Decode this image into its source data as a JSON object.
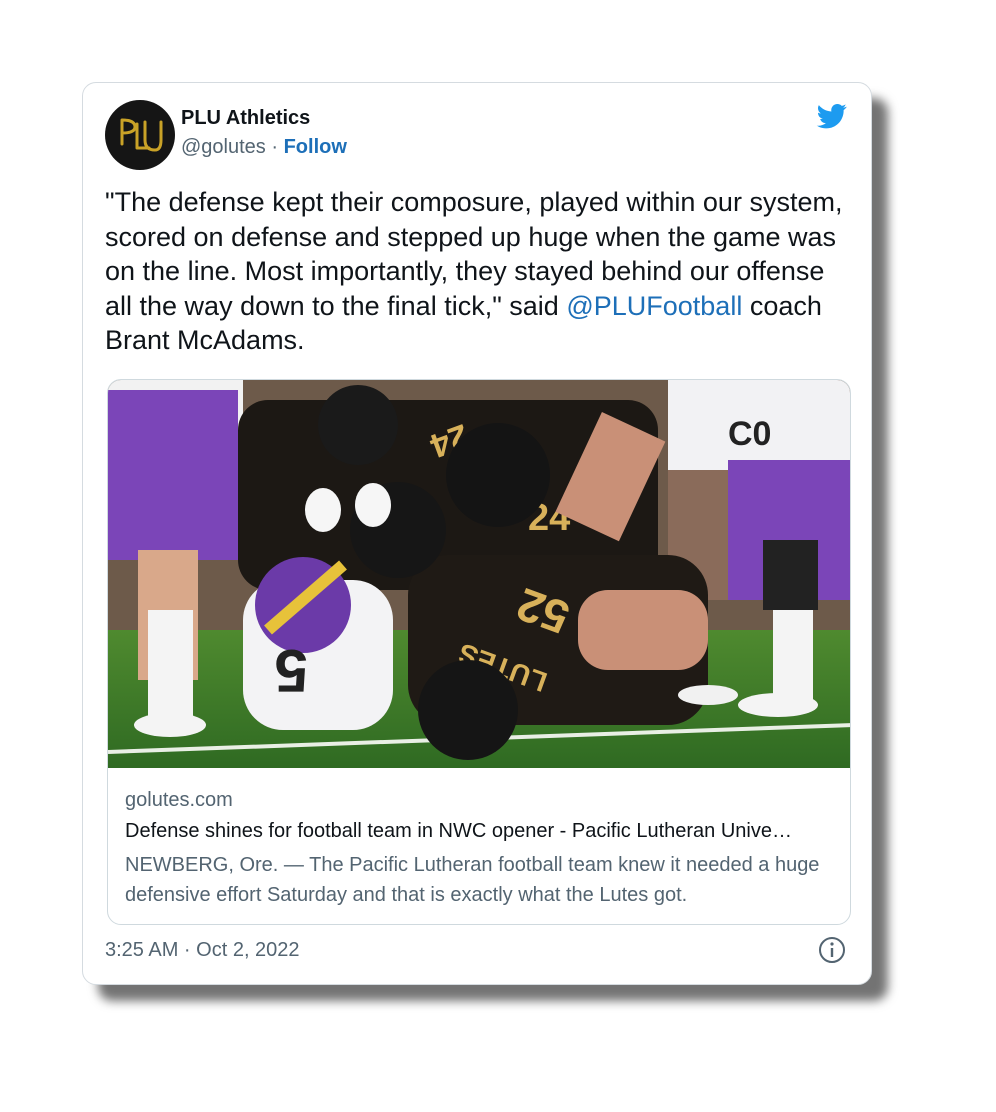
{
  "tweet": {
    "author": {
      "name": "PLU Athletics",
      "handle": "@golutes",
      "separator": " · ",
      "follow_label": "Follow",
      "avatar_monogram": "PLU"
    },
    "text_before_mention": "\"The defense kept their composure, played within our system, scored on defense and stepped up huge when the game was on the line. Most importantly, they stayed behind our offense all the way down to the final tick,\" said ",
    "mention": "@PLUFootball",
    "text_after_mention": " coach Brant McAdams.",
    "link_card": {
      "domain": "golutes.com",
      "title": "Defense shines for football team in NWC opener - Pacific Lutheran Unive…",
      "description": "NEWBERG, Ore. — The Pacific Lutheran football team knew it needed a huge defensive effort Saturday and that is exactly what the Lutes got."
    },
    "timestamp": "3:25 AM · Oct 2, 2022"
  },
  "icons": {
    "brand": "twitter-bird-icon",
    "info": "info-icon"
  },
  "colors": {
    "link": "#1d6fb8",
    "twitter_blue": "#1d9bf0",
    "text": "#0f1419",
    "muted": "#536471",
    "plu_gold": "#c9a227",
    "linfield_purple": "#6b3aa8"
  }
}
